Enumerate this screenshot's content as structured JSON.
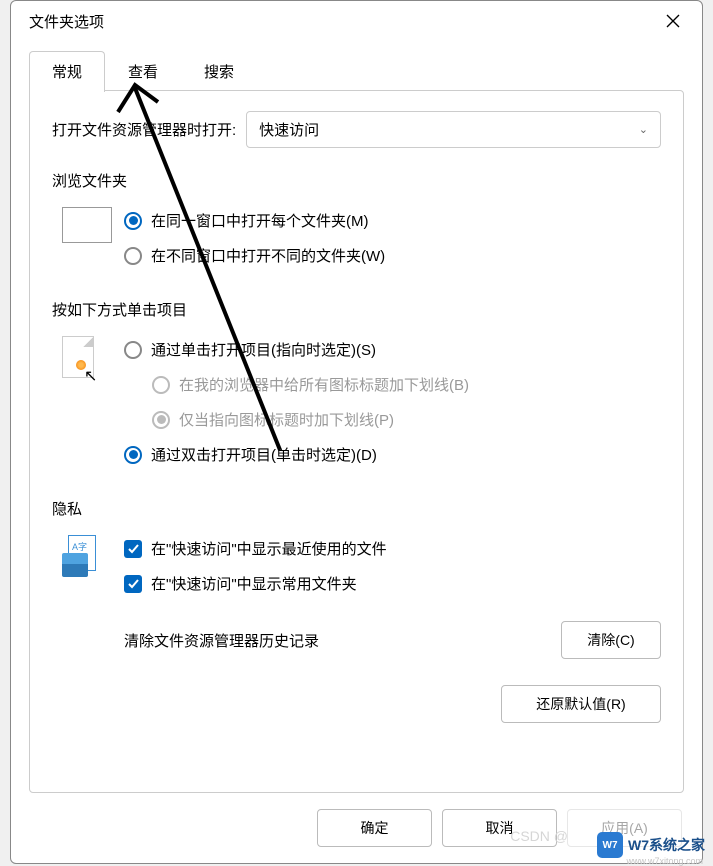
{
  "dialog": {
    "title": "文件夹选项"
  },
  "tabs": {
    "general": "常规",
    "view": "查看",
    "search": "搜索"
  },
  "openExplorer": {
    "label": "打开文件资源管理器时打开:",
    "selected": "快速访问"
  },
  "browseFolder": {
    "title": "浏览文件夹",
    "opt1": "在同一窗口中打开每个文件夹(M)",
    "opt2": "在不同窗口中打开不同的文件夹(W)"
  },
  "clickItems": {
    "title": "按如下方式单击项目",
    "opt1": "通过单击打开项目(指向时选定)(S)",
    "opt1a": "在我的浏览器中给所有图标标题加下划线(B)",
    "opt1b": "仅当指向图标标题时加下划线(P)",
    "opt2": "通过双击打开项目(单击时选定)(D)"
  },
  "privacy": {
    "title": "隐私",
    "chk1": "在\"快速访问\"中显示最近使用的文件",
    "chk2": "在\"快速访问\"中显示常用文件夹",
    "clearLabel": "清除文件资源管理器历史记录",
    "clearBtn": "清除(C)"
  },
  "restoreBtn": "还原默认值(R)",
  "bottom": {
    "ok": "确定",
    "cancel": "取消",
    "apply": "应用(A)"
  },
  "watermark": {
    "badge": "W7",
    "text": "W7系统之家",
    "url": "www.w7xitong.com",
    "csdn": "CSDN @"
  }
}
